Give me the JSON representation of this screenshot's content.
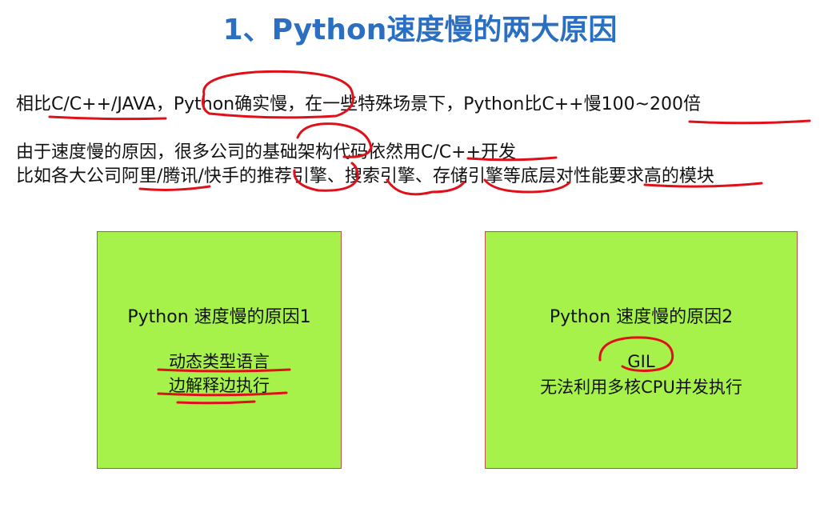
{
  "title": "1、Python速度慢的两大原因",
  "lines": [
    "相比C/C++/JAVA，Python确实慢，在一些特殊场景下，Python比C++慢100~200倍",
    "由于速度慢的原因，很多公司的基础架构代码依然用C/C++开发",
    "比如各大公司阿里/腾讯/快手的推荐引擎、搜索引擎、存储引擎等底层对性能要求高的模块"
  ],
  "boxes": [
    {
      "heading": "Python 速度慢的原因1",
      "items": [
        "动态类型语言",
        "边解释边执行"
      ]
    },
    {
      "heading": "Python 速度慢的原因2",
      "items": [
        "GIL",
        "无法利用多核CPU并发执行"
      ]
    }
  ],
  "colors": {
    "title": "#2a6fc2",
    "box_fill": "#a6f24a",
    "box_border": "#c0504d",
    "ink": "#e0101a"
  }
}
